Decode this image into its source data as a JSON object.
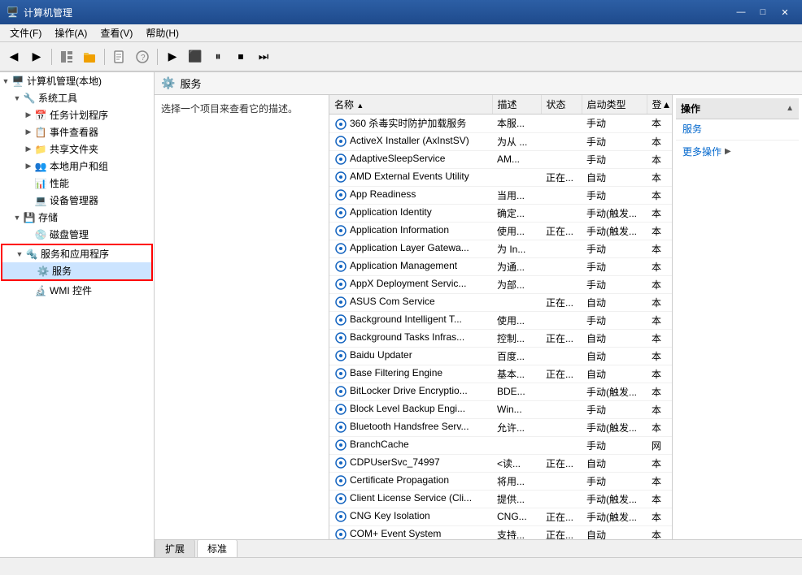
{
  "window": {
    "title": "计算机管理",
    "title_full": "计算机管理"
  },
  "titlebar": {
    "min": "—",
    "max": "□",
    "close": "✕"
  },
  "menubar": {
    "items": [
      "文件(F)",
      "操作(A)",
      "查看(V)",
      "帮助(H)"
    ]
  },
  "toolbar": {
    "buttons": [
      "◀",
      "▶",
      "🗂",
      "🗃",
      "🔍",
      "🔎",
      "?",
      "▶",
      "⬛",
      "⏸",
      "⏹",
      "⏭"
    ]
  },
  "sidebar": {
    "root_label": "计算机管理(本地)",
    "items": [
      {
        "id": "system-tools",
        "label": "系统工具",
        "level": 1,
        "expanded": true,
        "arrow": "▼"
      },
      {
        "id": "task-scheduler",
        "label": "任务计划程序",
        "level": 2,
        "expanded": false,
        "arrow": "▶"
      },
      {
        "id": "event-viewer",
        "label": "事件查看器",
        "level": 2,
        "expanded": false,
        "arrow": "▶"
      },
      {
        "id": "shared-folders",
        "label": "共享文件夹",
        "level": 2,
        "expanded": false,
        "arrow": "▶"
      },
      {
        "id": "local-users",
        "label": "本地用户和组",
        "level": 2,
        "expanded": false,
        "arrow": "▶"
      },
      {
        "id": "performance",
        "label": "性能",
        "level": 2,
        "expanded": false,
        "arrow": ""
      },
      {
        "id": "device-manager",
        "label": "设备管理器",
        "level": 2,
        "expanded": false,
        "arrow": ""
      },
      {
        "id": "storage",
        "label": "存储",
        "level": 1,
        "expanded": true,
        "arrow": "▼"
      },
      {
        "id": "disk-mgmt",
        "label": "磁盘管理",
        "level": 2,
        "expanded": false,
        "arrow": ""
      },
      {
        "id": "services-apps",
        "label": "服务和应用程序",
        "level": 1,
        "expanded": true,
        "arrow": "▼",
        "highlighted": true
      },
      {
        "id": "services",
        "label": "服务",
        "level": 2,
        "expanded": false,
        "arrow": "",
        "selected": true,
        "highlighted": true
      },
      {
        "id": "wmi",
        "label": "WMI 控件",
        "level": 2,
        "expanded": false,
        "arrow": ""
      }
    ]
  },
  "services_panel": {
    "title": "服务",
    "description_prompt": "选择一个项目来查看它的描述。",
    "columns": [
      {
        "id": "name",
        "label": "名称",
        "sort": "▲"
      },
      {
        "id": "desc",
        "label": "描述"
      },
      {
        "id": "status",
        "label": "状态"
      },
      {
        "id": "startup",
        "label": "启动类型"
      },
      {
        "id": "logon",
        "label": "登▲"
      }
    ],
    "services": [
      {
        "name": "360 杀毒实时防护加载服务",
        "desc": "本服...",
        "status": "",
        "startup": "手动",
        "logon": "本"
      },
      {
        "name": "ActiveX Installer (AxInstSV)",
        "desc": "为从 ...",
        "status": "",
        "startup": "手动",
        "logon": "本"
      },
      {
        "name": "AdaptiveSleepService",
        "desc": "AM...",
        "status": "",
        "startup": "手动",
        "logon": "本"
      },
      {
        "name": "AMD External Events Utility",
        "desc": "",
        "status": "正在...",
        "startup": "自动",
        "logon": "本"
      },
      {
        "name": "App Readiness",
        "desc": "当用...",
        "status": "",
        "startup": "手动",
        "logon": "本"
      },
      {
        "name": "Application Identity",
        "desc": "确定...",
        "status": "",
        "startup": "手动(触发...",
        "logon": "本"
      },
      {
        "name": "Application Information",
        "desc": "使用...",
        "status": "正在...",
        "startup": "手动(触发...",
        "logon": "本"
      },
      {
        "name": "Application Layer Gatewa...",
        "desc": "为 In...",
        "status": "",
        "startup": "手动",
        "logon": "本"
      },
      {
        "name": "Application Management",
        "desc": "为通...",
        "status": "",
        "startup": "手动",
        "logon": "本"
      },
      {
        "name": "AppX Deployment Servic...",
        "desc": "为部...",
        "status": "",
        "startup": "手动",
        "logon": "本"
      },
      {
        "name": "ASUS Com Service",
        "desc": "",
        "status": "正在...",
        "startup": "自动",
        "logon": "本"
      },
      {
        "name": "Background Intelligent T...",
        "desc": "使用...",
        "status": "",
        "startup": "手动",
        "logon": "本"
      },
      {
        "name": "Background Tasks Infras...",
        "desc": "控制...",
        "status": "正在...",
        "startup": "自动",
        "logon": "本"
      },
      {
        "name": "Baidu Updater",
        "desc": "百度...",
        "status": "",
        "startup": "自动",
        "logon": "本"
      },
      {
        "name": "Base Filtering Engine",
        "desc": "基本...",
        "status": "正在...",
        "startup": "自动",
        "logon": "本"
      },
      {
        "name": "BitLocker Drive Encryptio...",
        "desc": "BDE...",
        "status": "",
        "startup": "手动(触发...",
        "logon": "本"
      },
      {
        "name": "Block Level Backup Engi...",
        "desc": "Win...",
        "status": "",
        "startup": "手动",
        "logon": "本"
      },
      {
        "name": "Bluetooth Handsfree Serv...",
        "desc": "允许...",
        "status": "",
        "startup": "手动(触发...",
        "logon": "本"
      },
      {
        "name": "BranchCache",
        "desc": "",
        "status": "",
        "startup": "手动",
        "logon": "网"
      },
      {
        "name": "CDPUserSvc_74997",
        "desc": "<读...",
        "status": "正在...",
        "startup": "自动",
        "logon": "本"
      },
      {
        "name": "Certificate Propagation",
        "desc": "将用...",
        "status": "",
        "startup": "手动",
        "logon": "本"
      },
      {
        "name": "Client License Service (Cli...",
        "desc": "提供...",
        "status": "",
        "startup": "手动(触发...",
        "logon": "本"
      },
      {
        "name": "CNG Key Isolation",
        "desc": "CNG...",
        "status": "正在...",
        "startup": "手动(触发...",
        "logon": "本"
      },
      {
        "name": "COM+ Event System",
        "desc": "支持...",
        "status": "正在...",
        "startup": "自动",
        "logon": "本"
      }
    ]
  },
  "action_panel": {
    "title": "操作",
    "services_label": "服务",
    "more_actions": "更多操作",
    "arrow": "▶"
  },
  "bottom_tabs": [
    {
      "label": "扩展",
      "active": false
    },
    {
      "label": "标准",
      "active": true
    }
  ]
}
